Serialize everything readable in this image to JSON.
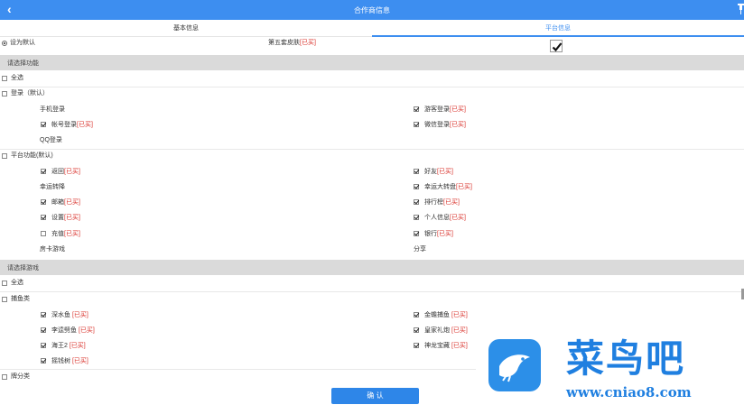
{
  "header": {
    "title": "合作商信息",
    "back_icon": "‹"
  },
  "tabs": [
    {
      "label": "基本信息",
      "active": false
    },
    {
      "label": "平台信息",
      "active": true
    }
  ],
  "default": {
    "label": "设为默认",
    "skin_label": "第五套皮肤",
    "skin_status": "[已买]",
    "skin_checked": true
  },
  "sections": {
    "features_header": "请选择功能",
    "select_all_1": "全选",
    "login_group": "登录（默认）",
    "login_items": [
      {
        "label": "手机登录",
        "status": "",
        "checked": false,
        "checkbox": false
      },
      {
        "label": "游客登录",
        "status": "[已买]",
        "checked": true,
        "checkbox": true
      },
      {
        "label": "帐号登录",
        "status": "[已买]",
        "checked": true,
        "checkbox": true
      },
      {
        "label": "微信登录",
        "status": "[已买]",
        "checked": true,
        "checkbox": true
      },
      {
        "label": "QQ登录",
        "status": "",
        "checked": false,
        "checkbox": false
      }
    ],
    "platform_group": "平台功能(默认)",
    "platform_items": [
      {
        "label": "返回",
        "status": "[已买]",
        "checked": true,
        "checkbox": true
      },
      {
        "label": "好友",
        "status": "[已买]",
        "checked": true,
        "checkbox": true
      },
      {
        "label": "幸运转降",
        "status": "",
        "checked": false,
        "checkbox": false
      },
      {
        "label": "幸运大转盘",
        "status": "[已买]",
        "checked": true,
        "checkbox": true
      },
      {
        "label": "邮箱",
        "status": "[已买]",
        "checked": true,
        "checkbox": true
      },
      {
        "label": "排行榜",
        "status": "[已买]",
        "checked": true,
        "checkbox": true
      },
      {
        "label": "设置",
        "status": "[已买]",
        "checked": true,
        "checkbox": true
      },
      {
        "label": "个人信息",
        "status": "[已买]",
        "checked": true,
        "checkbox": true
      },
      {
        "label": "充值",
        "status": "[已买]",
        "checked": false,
        "checkbox": true
      },
      {
        "label": "银行",
        "status": "[已买]",
        "checked": true,
        "checkbox": true
      },
      {
        "label": "房卡游戏",
        "status": "",
        "checked": false,
        "checkbox": false
      },
      {
        "label": "分享",
        "status": "",
        "checked": false,
        "checkbox": false
      }
    ],
    "games_header": "请选择游戏",
    "select_all_2": "全选",
    "fish_group": "捕鱼类",
    "fish_items": [
      {
        "label": "深水鱼",
        "status": "[已买]",
        "checked": true
      },
      {
        "label": "金蟾捕鱼",
        "status": "[已买]",
        "checked": true
      },
      {
        "label": "李逵劈鱼",
        "status": "[已买]",
        "checked": true
      },
      {
        "label": "皇家礼炮",
        "status": "[已买]",
        "checked": true
      },
      {
        "label": "海王2",
        "status": "[已买]",
        "checked": true
      },
      {
        "label": "神龙宝藏",
        "status": "[已买]",
        "checked": true
      },
      {
        "label": "摇钱树",
        "status": "[已买]",
        "checked": true
      }
    ],
    "other_group": "牌分类"
  },
  "confirm_label": "确 认",
  "watermark": {
    "brand": "菜鸟吧",
    "url": "www.cniao8.com"
  },
  "colors": {
    "accent": "#3d8ef0",
    "status_red": "#d9302a",
    "band": "#dadada",
    "button": "#2e86e8"
  }
}
